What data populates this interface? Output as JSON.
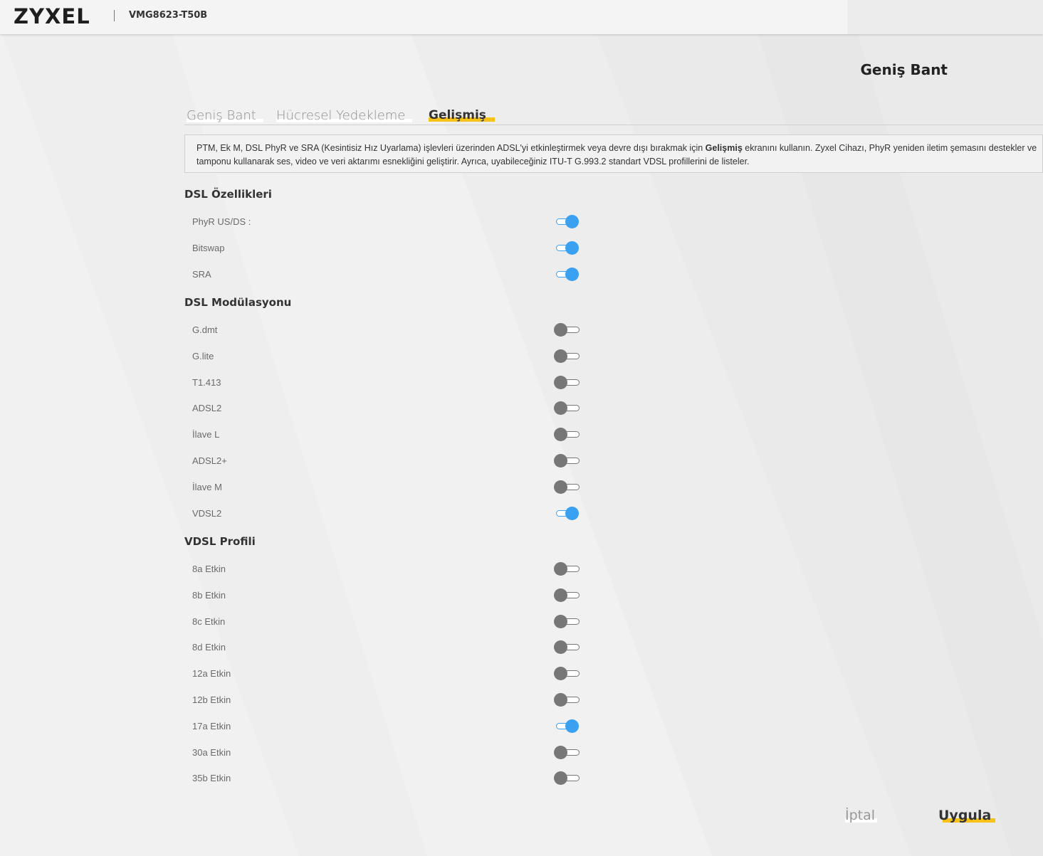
{
  "header": {
    "brand": "ZYXEL",
    "model": "VMG8623-T50B"
  },
  "page": {
    "title": "Geniş Bant"
  },
  "tabs": [
    {
      "label": "Geniş Bant",
      "active": false
    },
    {
      "label": "Hücresel Yedekleme",
      "active": false
    },
    {
      "label": "Gelişmiş",
      "active": true
    }
  ],
  "info": {
    "text_before": "PTM, Ek M, DSL PhyR ve SRA (Kesintisiz Hız Uyarlama) işlevleri üzerinden ADSL'yi etkinleştirmek veya devre dışı bırakmak için ",
    "bold": "Gelişmiş",
    "text_after": " ekranını kullanın. Zyxel Cihazı, PhyR yeniden iletim şemasını destekler ve",
    "line2": "tamponu kullanarak ses, video ve veri aktarımı esnekliğini geliştirir. Ayrıca, uyabileceğiniz ITU-T G.993.2 standart VDSL profillerini de listeler."
  },
  "sections": {
    "dsl_features": {
      "title": "DSL Özellikleri",
      "items": [
        {
          "label": "PhyR US/DS :",
          "on": true
        },
        {
          "label": "Bitswap",
          "on": true
        },
        {
          "label": "SRA",
          "on": true
        }
      ]
    },
    "dsl_modulation": {
      "title": "DSL Modülasyonu",
      "items": [
        {
          "label": "G.dmt",
          "on": false
        },
        {
          "label": "G.lite",
          "on": false
        },
        {
          "label": "T1.413",
          "on": false
        },
        {
          "label": "ADSL2",
          "on": false
        },
        {
          "label": "İlave L",
          "on": false
        },
        {
          "label": "ADSL2+",
          "on": false
        },
        {
          "label": "İlave M",
          "on": false
        },
        {
          "label": "VDSL2",
          "on": true
        }
      ]
    },
    "vdsl_profile": {
      "title": "VDSL Profili",
      "items": [
        {
          "label": "8a Etkin",
          "on": false
        },
        {
          "label": "8b Etkin",
          "on": false
        },
        {
          "label": "8c Etkin",
          "on": false
        },
        {
          "label": "8d Etkin",
          "on": false
        },
        {
          "label": "12a Etkin",
          "on": false
        },
        {
          "label": "12b Etkin",
          "on": false
        },
        {
          "label": "17a Etkin",
          "on": true
        },
        {
          "label": "30a Etkin",
          "on": false
        },
        {
          "label": "35b Etkin",
          "on": false
        }
      ]
    }
  },
  "buttons": {
    "cancel": "İptal",
    "apply": "Uygula"
  },
  "colors": {
    "accent": "#f7c31b",
    "toggle_on": "#3aa0f2",
    "toggle_off": "#777777"
  }
}
